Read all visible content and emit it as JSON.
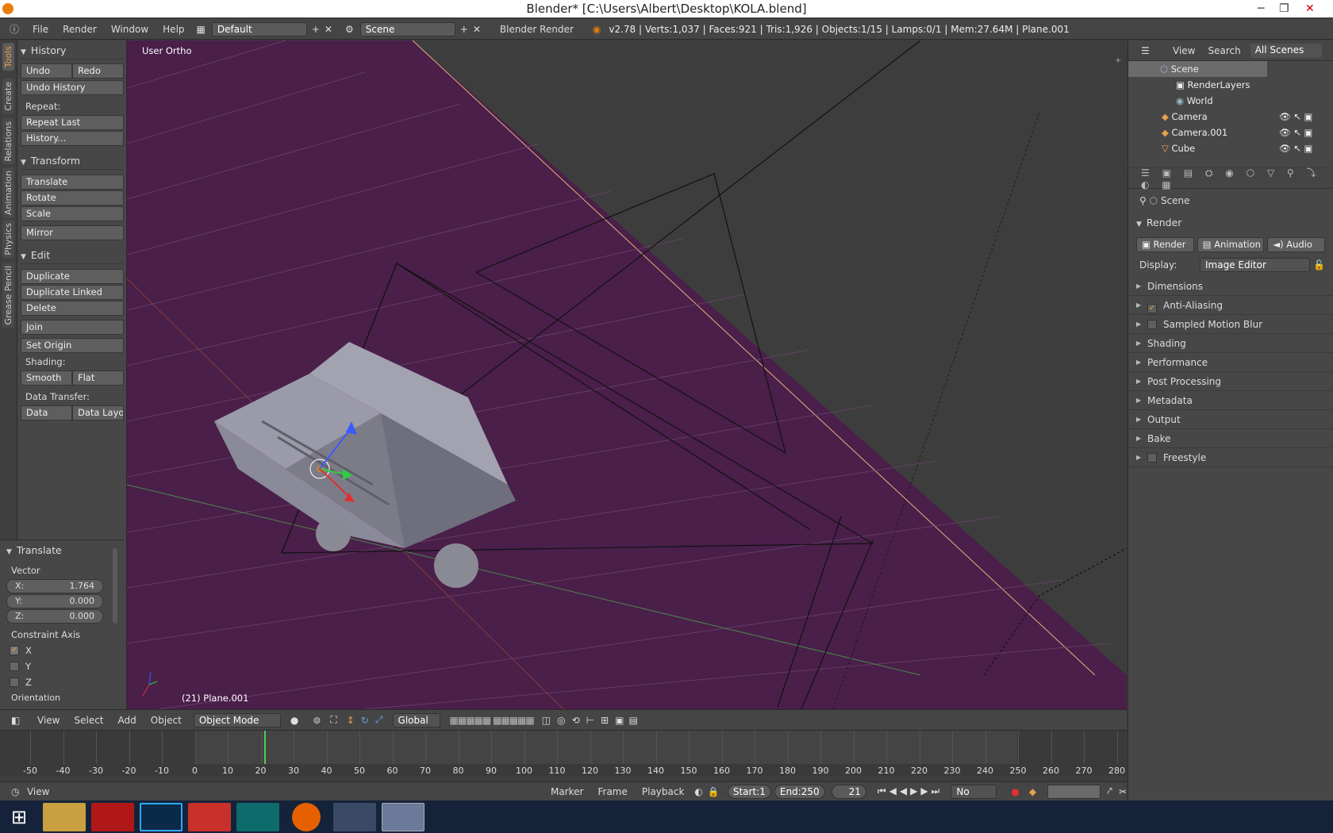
{
  "window": {
    "title": "Blender* [C:\\Users\\Albert\\Desktop\\KOLA.blend]"
  },
  "top_menu": {
    "items": [
      "File",
      "Render",
      "Window",
      "Help"
    ],
    "layout": "Default",
    "scene": "Scene",
    "engine": "Blender Render",
    "stats": "v2.78 | Verts:1,037 | Faces:921 | Tris:1,926 | Objects:1/15 | Lamps:0/1 | Mem:27.64M | Plane.001"
  },
  "tool_tabs": [
    "Tools",
    "Create",
    "Relations",
    "Animation",
    "Physics",
    "Grease Pencil"
  ],
  "tools": {
    "history": {
      "title": "History",
      "undo": "Undo",
      "redo": "Redo",
      "undo_history": "Undo History",
      "repeat_label": "Repeat:",
      "repeat_last": "Repeat Last",
      "history_btn": "History..."
    },
    "transform": {
      "title": "Transform",
      "translate": "Translate",
      "rotate": "Rotate",
      "scale": "Scale",
      "mirror": "Mirror"
    },
    "edit": {
      "title": "Edit",
      "duplicate": "Duplicate",
      "duplicate_linked": "Duplicate Linked",
      "delete": "Delete",
      "join": "Join",
      "set_origin": "Set Origin",
      "shading_label": "Shading:",
      "smooth": "Smooth",
      "flat": "Flat",
      "data_transfer_label": "Data Transfer:",
      "data": "Data",
      "data_layo": "Data Layo"
    }
  },
  "operator": {
    "title": "Translate",
    "vector_label": "Vector",
    "x_label": "X:",
    "x": "1.764",
    "y_label": "Y:",
    "y": "0.000",
    "z_label": "Z:",
    "z": "0.000",
    "constraint_label": "Constraint Axis",
    "cx": "X",
    "cy": "Y",
    "cz": "Z",
    "orientation": "Orientation"
  },
  "viewport": {
    "view_name": "User Ortho",
    "object_label": "(21) Plane.001"
  },
  "viewport_header": {
    "items": [
      "View",
      "Select",
      "Add",
      "Object"
    ],
    "mode": "Object Mode",
    "orientation": "Global"
  },
  "timeline": {
    "ticks": [
      "-50",
      "-40",
      "-30",
      "-20",
      "-10",
      "0",
      "10",
      "20",
      "30",
      "40",
      "50",
      "60",
      "70",
      "80",
      "90",
      "100",
      "110",
      "120",
      "130",
      "140",
      "150",
      "160",
      "170",
      "180",
      "190",
      "200",
      "210",
      "220",
      "230",
      "240",
      "250",
      "260",
      "270",
      "280"
    ],
    "current_frame": 21
  },
  "timeline_header": {
    "items": [
      "View",
      "Marker",
      "Frame",
      "Playback"
    ],
    "start_label": "Start:",
    "start": "1",
    "end_label": "End:",
    "end": "250",
    "frame": "21",
    "sync": "No Sync"
  },
  "outliner": {
    "view": "View",
    "search": "Search",
    "filter": "All Scenes",
    "rows": [
      "Scene",
      "RenderLayers",
      "World",
      "Camera",
      "Camera.001",
      "Cube"
    ]
  },
  "properties": {
    "context": "Scene",
    "render_title": "Render",
    "render_btn": "Render",
    "animation_btn": "Animation",
    "audio_btn": "Audio",
    "display_label": "Display:",
    "display_value": "Image Editor",
    "sections": [
      "Dimensions",
      "Anti-Aliasing",
      "Sampled Motion Blur",
      "Shading",
      "Performance",
      "Post Processing",
      "Metadata",
      "Output",
      "Bake",
      "Freestyle"
    ]
  },
  "colors": {
    "viewport_bg": "#3d3d3d",
    "plane": "#4a1f4a",
    "accent": "#e8a048"
  }
}
